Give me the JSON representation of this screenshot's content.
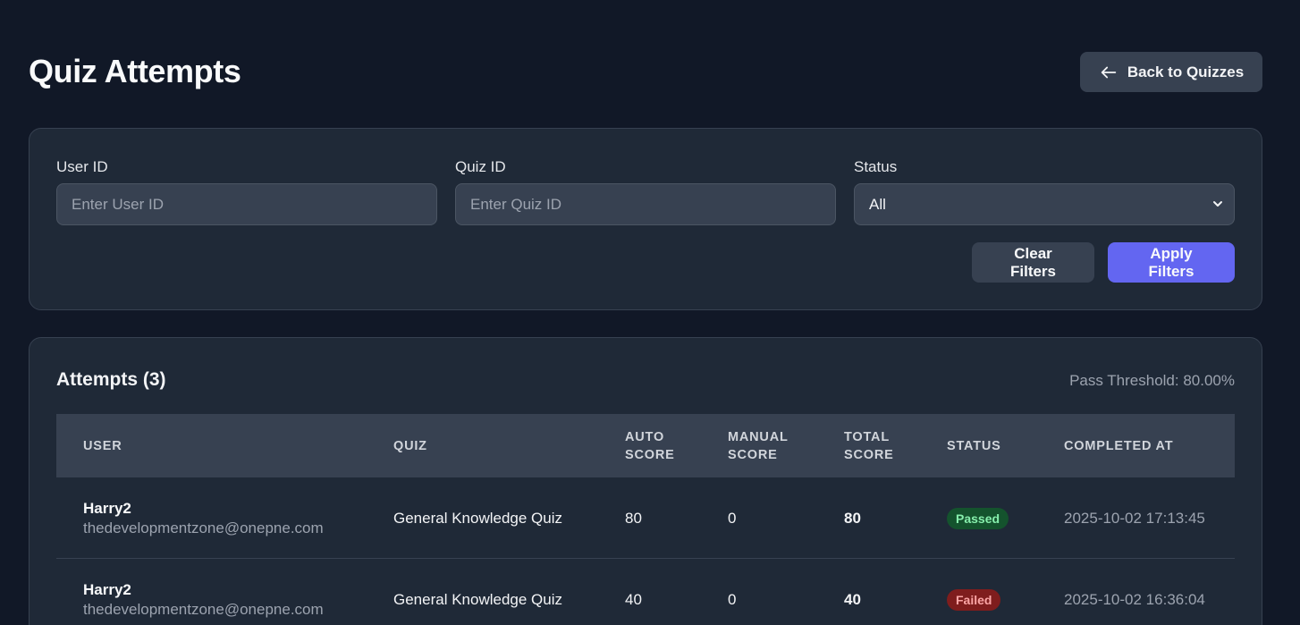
{
  "header": {
    "title": "Quiz Attempts",
    "back_label": "Back to Quizzes"
  },
  "filters": {
    "user_id": {
      "label": "User ID",
      "placeholder": "Enter User ID",
      "value": ""
    },
    "quiz_id": {
      "label": "Quiz ID",
      "placeholder": "Enter Quiz ID",
      "value": ""
    },
    "status": {
      "label": "Status",
      "selected": "All"
    },
    "clear_label": "Clear Filters",
    "apply_label": "Apply Filters"
  },
  "attempts": {
    "title": "Attempts (3)",
    "threshold": "Pass Threshold: 80.00%",
    "columns": [
      "USER",
      "QUIZ",
      "AUTO SCORE",
      "MANUAL SCORE",
      "TOTAL SCORE",
      "STATUS",
      "COMPLETED AT"
    ],
    "rows": [
      {
        "user_name": "Harry2",
        "user_email": "thedevelopmentzone@onepne.com",
        "quiz": "General Knowledge Quiz",
        "auto_score": "80",
        "manual_score": "0",
        "total_score": "80",
        "status": "Passed",
        "completed_at": "2025-10-02 17:13:45"
      },
      {
        "user_name": "Harry2",
        "user_email": "thedevelopmentzone@onepne.com",
        "quiz": "General Knowledge Quiz",
        "auto_score": "40",
        "manual_score": "0",
        "total_score": "40",
        "status": "Failed",
        "completed_at": "2025-10-02 16:36:04"
      }
    ]
  },
  "colors": {
    "background": "#111827",
    "card": "#1f2937",
    "accent": "#6366f1",
    "passed": "#14532d",
    "failed": "#7f1d1d"
  }
}
